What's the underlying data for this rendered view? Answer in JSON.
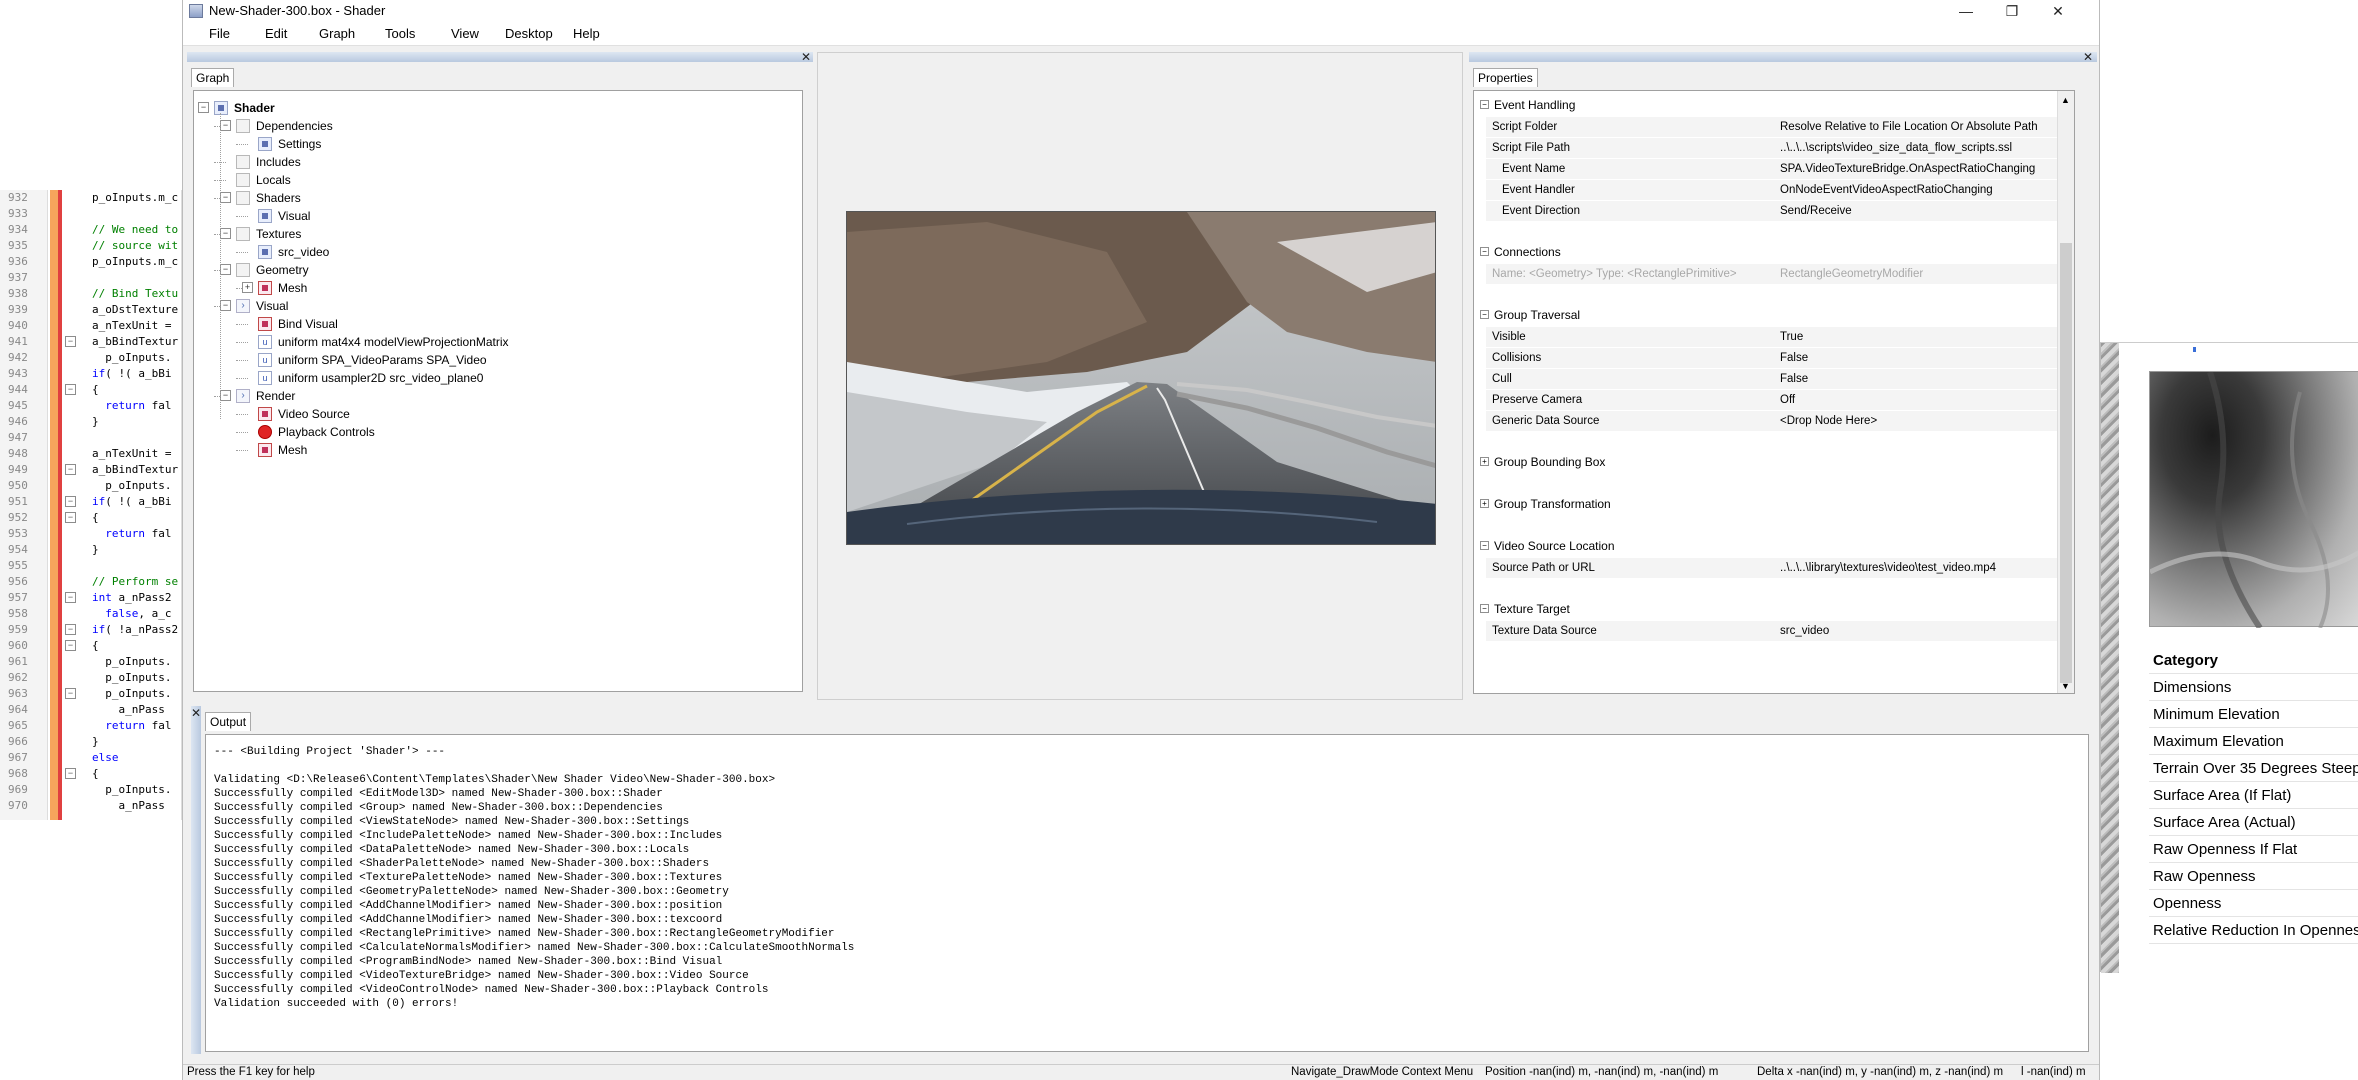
{
  "code_editor": {
    "line_numbers": [
      "932",
      "933",
      "934",
      "935",
      "936",
      "937",
      "938",
      "939",
      "940",
      "941",
      "942",
      "943",
      "944",
      "945",
      "946",
      "947",
      "948",
      "949",
      "950",
      "951",
      "952",
      "953",
      "954",
      "955",
      "956",
      "957",
      "958",
      "959",
      "960",
      "961",
      "962",
      "963",
      "964",
      "965",
      "966",
      "967",
      "968",
      "969",
      "970"
    ],
    "lines": [
      "p_oInputs.m_c",
      "",
      "// We need to",
      "// source wit",
      "p_oInputs.m_c",
      "",
      "// Bind Textu",
      "a_oDstTexture",
      "a_nTexUnit =",
      "a_bBindTextur",
      "  p_oInputs.",
      "if( !( a_bBi",
      "{",
      "  return fal",
      "}",
      "",
      "a_nTexUnit =",
      "a_bBindTextur",
      "  p_oInputs.",
      "if( !( a_bBi",
      "{",
      "  return fal",
      "}",
      "",
      "// Perform se",
      "int a_nPass2",
      "  false, a_c",
      "if( !a_nPass2",
      "{",
      "  p_oInputs.",
      "  p_oInputs.",
      "  p_oInputs.",
      "    a_nPass",
      "  return fal",
      "}",
      "else",
      "{",
      "  p_oInputs.",
      "    a_nPass"
    ]
  },
  "window": {
    "title": "New-Shader-300.box - Shader",
    "minimize": "—",
    "restore": "❐",
    "close": "✕"
  },
  "menu": [
    "File",
    "Edit",
    "Graph",
    "Tools",
    "View",
    "Desktop",
    "Help"
  ],
  "graph_panel": {
    "tab": "Graph",
    "tree": [
      {
        "label": "Shader",
        "level": 0,
        "toggle": "−",
        "icon": "node-icon",
        "bold": true
      },
      {
        "label": "Dependencies",
        "level": 1,
        "toggle": "−",
        "icon": "folder-icon"
      },
      {
        "label": "Settings",
        "level": 2,
        "toggle": "",
        "icon": "node-icon"
      },
      {
        "label": "Includes",
        "level": 1,
        "toggle": "",
        "icon": "folder-icon"
      },
      {
        "label": "Locals",
        "level": 1,
        "toggle": "",
        "icon": "folder-icon"
      },
      {
        "label": "Shaders",
        "level": 1,
        "toggle": "−",
        "icon": "folder-icon"
      },
      {
        "label": "Visual",
        "level": 2,
        "toggle": "",
        "icon": "node-icon"
      },
      {
        "label": "Textures",
        "level": 1,
        "toggle": "−",
        "icon": "folder-icon"
      },
      {
        "label": "src_video",
        "level": 2,
        "toggle": "",
        "icon": "node-icon"
      },
      {
        "label": "Geometry",
        "level": 1,
        "toggle": "−",
        "icon": "folder-icon"
      },
      {
        "label": "Mesh",
        "level": 2,
        "toggle": "+",
        "icon": "shader-icon"
      },
      {
        "label": "Visual",
        "level": 1,
        "toggle": "−",
        "icon": "chevron-icon"
      },
      {
        "label": "Bind Visual",
        "level": 2,
        "toggle": "",
        "icon": "shader-icon"
      },
      {
        "label": "uniform mat4x4 modelViewProjectionMatrix",
        "level": 2,
        "toggle": "",
        "icon": "uniform-icon"
      },
      {
        "label": "uniform SPA_VideoParams SPA_Video",
        "level": 2,
        "toggle": "",
        "icon": "uniform-icon"
      },
      {
        "label": "uniform usampler2D src_video_plane0",
        "level": 2,
        "toggle": "",
        "icon": "uniform-icon"
      },
      {
        "label": "Render",
        "level": 1,
        "toggle": "−",
        "icon": "chevron-icon"
      },
      {
        "label": "Video Source",
        "level": 2,
        "toggle": "",
        "icon": "shader-icon"
      },
      {
        "label": "Playback Controls",
        "level": 2,
        "toggle": "",
        "icon": "record-icon"
      },
      {
        "label": "Mesh",
        "level": 2,
        "toggle": "",
        "icon": "shader-icon"
      }
    ]
  },
  "properties_panel": {
    "tab": "Properties",
    "sections": [
      {
        "title": "Event Handling",
        "expanded": true,
        "rows": [
          {
            "name": "Script Folder",
            "value": "Resolve Relative to File Location Or Absolute Path",
            "indent": false
          },
          {
            "name": "Script File Path",
            "value": "..\\..\\..\\scripts\\video_size_data_flow_scripts.ssl",
            "indent": false
          },
          {
            "name": "Event Name",
            "value": "SPA.VideoTextureBridge.OnAspectRatioChanging",
            "indent": true
          },
          {
            "name": "Event Handler",
            "value": "OnNodeEventVideoAspectRatioChanging",
            "indent": true
          },
          {
            "name": "Event Direction",
            "value": "Send/Receive",
            "indent": true
          }
        ]
      },
      {
        "title": "Connections",
        "expanded": true,
        "rows": [
          {
            "name": "Name: <Geometry> Type: <RectanglePrimitive>",
            "value": "RectangleGeometryModifier",
            "indent": false,
            "disabled": true
          }
        ]
      },
      {
        "title": "Group Traversal",
        "expanded": true,
        "rows": [
          {
            "name": "Visible",
            "value": "True",
            "indent": false
          },
          {
            "name": "Collisions",
            "value": "False",
            "indent": false
          },
          {
            "name": "Cull",
            "value": "False",
            "indent": false
          },
          {
            "name": "Preserve Camera",
            "value": "Off",
            "indent": false
          },
          {
            "name": "Generic Data Source",
            "value": "<Drop Node Here>",
            "indent": false
          }
        ]
      },
      {
        "title": "Group Bounding Box",
        "expanded": false,
        "rows": []
      },
      {
        "title": "Group Transformation",
        "expanded": false,
        "rows": []
      },
      {
        "title": "Video Source Location",
        "expanded": true,
        "rows": [
          {
            "name": "Source Path or URL",
            "value": "..\\..\\..\\library\\textures\\video\\test_video.mp4",
            "indent": false
          }
        ]
      },
      {
        "title": "Texture Target",
        "expanded": true,
        "rows": [
          {
            "name": "Texture Data Source",
            "value": "src_video",
            "indent": false
          }
        ]
      }
    ]
  },
  "output_panel": {
    "tab": "Output",
    "lines": [
      "--- <Building Project 'Shader'> ---",
      "",
      "Validating <D:\\Release6\\Content\\Templates\\Shader\\New Shader Video\\New-Shader-300.box>",
      "Successfully compiled <EditModel3D> named New-Shader-300.box::Shader",
      "Successfully compiled <Group> named New-Shader-300.box::Dependencies",
      "Successfully compiled <ViewStateNode> named New-Shader-300.box::Settings",
      "Successfully compiled <IncludePaletteNode> named New-Shader-300.box::Includes",
      "Successfully compiled <DataPaletteNode> named New-Shader-300.box::Locals",
      "Successfully compiled <ShaderPaletteNode> named New-Shader-300.box::Shaders",
      "Successfully compiled <TexturePaletteNode> named New-Shader-300.box::Textures",
      "Successfully compiled <GeometryPaletteNode> named New-Shader-300.box::Geometry",
      "Successfully compiled <AddChannelModifier> named New-Shader-300.box::position",
      "Successfully compiled <AddChannelModifier> named New-Shader-300.box::texcoord",
      "Successfully compiled <RectanglePrimitive> named New-Shader-300.box::RectangleGeometryModifier",
      "Successfully compiled <CalculateNormalsModifier> named New-Shader-300.box::CalculateSmoothNormals",
      "Successfully compiled <ProgramBindNode> named New-Shader-300.box::Bind Visual",
      "Successfully compiled <VideoTextureBridge> named New-Shader-300.box::Video Source",
      "Successfully compiled <VideoControlNode> named New-Shader-300.box::Playback Controls",
      "Validation succeeded with (0) errors!"
    ]
  },
  "status_bar": {
    "help": "Press the F1 key for help",
    "mode": "Navigate_DrawMode Context Menu",
    "position": "Position -nan(ind) m,  -nan(ind) m,  -nan(ind) m",
    "delta": "Delta x -nan(ind) m,  y -nan(ind) m,  z -nan(ind) m",
    "length": "l -nan(ind) m"
  },
  "side_window": {
    "category_header": "Category",
    "categories": [
      "Dimensions",
      "Minimum Elevation",
      "Maximum Elevation",
      "Terrain Over 35 Degrees Steep",
      "Surface Area (If Flat)",
      "Surface Area (Actual)",
      "Raw Openness If Flat",
      "Raw Openness",
      "Openness",
      "Relative Reduction In Openness"
    ]
  }
}
